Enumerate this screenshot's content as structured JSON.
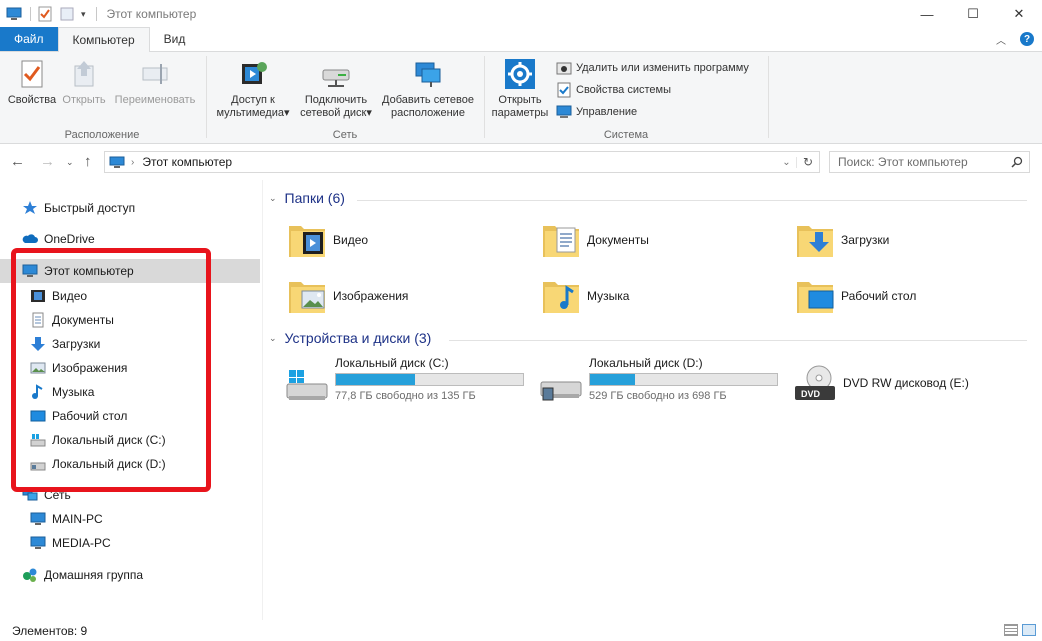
{
  "window": {
    "title": "Этот компьютер"
  },
  "ribbon_tabs": {
    "file": "Файл",
    "computer": "Компьютер",
    "view": "Вид"
  },
  "ribbon": {
    "location": {
      "label": "Расположение",
      "properties": "Свойства",
      "open": "Открыть",
      "rename": "Переименовать"
    },
    "network": {
      "label": "Сеть",
      "media_access": [
        "Доступ к",
        "мультимедиа"
      ],
      "map_drive": [
        "Подключить",
        "сетевой диск"
      ],
      "add_location": [
        "Добавить сетевое",
        "расположение"
      ]
    },
    "system": {
      "label": "Система",
      "open_settings": [
        "Открыть",
        "параметры"
      ],
      "uninstall": "Удалить или изменить программу",
      "system_props": "Свойства системы",
      "manage": "Управление"
    }
  },
  "address": {
    "path": "Этот компьютер",
    "search_placeholder": "Поиск: Этот компьютер"
  },
  "nav": {
    "quick_access": "Быстрый доступ",
    "onedrive": "OneDrive",
    "this_pc": "Этот компьютер",
    "children": [
      "Видео",
      "Документы",
      "Загрузки",
      "Изображения",
      "Музыка",
      "Рабочий стол",
      "Локальный диск (C:)",
      "Локальный диск (D:)"
    ],
    "network": "Сеть",
    "network_children": [
      "MAIN-PC",
      "MEDIA-PC"
    ],
    "homegroup": "Домашняя группа"
  },
  "content": {
    "folders_header": "Папки (6)",
    "folders": [
      "Видео",
      "Документы",
      "Загрузки",
      "Изображения",
      "Музыка",
      "Рабочий стол"
    ],
    "devices_header": "Устройства и диски (3)",
    "drives": [
      {
        "name": "Локальный диск (C:)",
        "free": "77,8 ГБ свободно из 135 ГБ",
        "used_fraction": 0.42
      },
      {
        "name": "Локальный диск (D:)",
        "free": "529 ГБ свободно из 698 ГБ",
        "used_fraction": 0.24
      }
    ],
    "dvd": {
      "name": "DVD RW дисковод (E:)",
      "badge": "DVD"
    }
  },
  "status": {
    "items": "Элементов: 9"
  },
  "colors": {
    "accent": "#1979ca",
    "highlight": "#e8141c",
    "bar_fill": "#26a0da",
    "folder_yellow": "#f8d775"
  }
}
